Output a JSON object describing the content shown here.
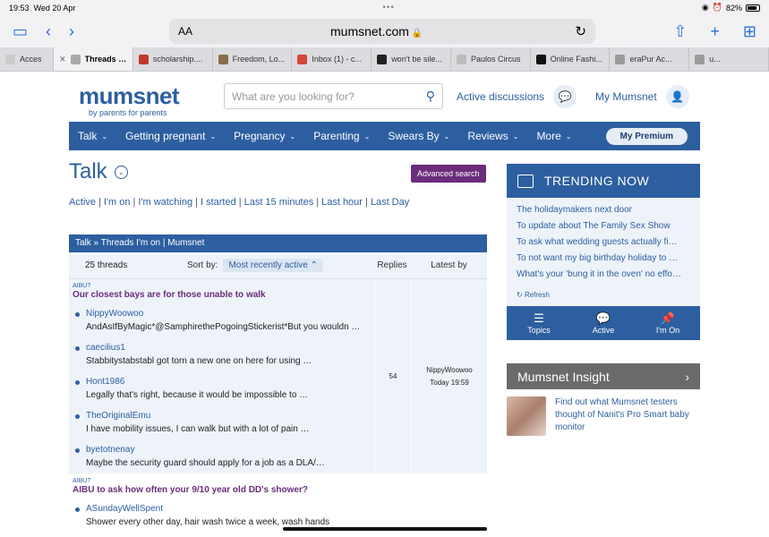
{
  "status": {
    "time": "19:53",
    "date": "Wed 20 Apr",
    "battery": "82%",
    "battery_level": 0.82
  },
  "browser": {
    "aa_label": "AA",
    "url": "mumsnet.com",
    "tabs": [
      {
        "label": "Acces",
        "color": "#cccccc"
      },
      {
        "label": "Threads I'm...",
        "color": "#aaaaaa",
        "active": true
      },
      {
        "label": "scholarship....",
        "color": "#c0392b"
      },
      {
        "label": "Freedom, Lo...",
        "color": "#8a6d4a"
      },
      {
        "label": "Inbox (1) - c...",
        "color": "#d44638"
      },
      {
        "label": "won't be sile...",
        "color": "#222222"
      },
      {
        "label": "Paulos Circus",
        "color": "#bbbbbb"
      },
      {
        "label": "Online Fashi...",
        "color": "#111111"
      },
      {
        "label": "eraPur Ac...",
        "color": "#9a9a9a"
      },
      {
        "label": "u...",
        "color": "#9a9a9a"
      }
    ]
  },
  "site": {
    "logo": "mumsnet",
    "tagline": "by parents for parents",
    "search_placeholder": "What are you looking for?",
    "active_discussions": "Active discussions",
    "my_mumsnet": "My Mumsnet"
  },
  "nav": {
    "items": [
      "Talk",
      "Getting pregnant",
      "Pregnancy",
      "Parenting",
      "Swears By",
      "Reviews",
      "More"
    ],
    "premium": "My Premium"
  },
  "talk": {
    "title": "Talk",
    "advanced_search": "Advanced search",
    "links": [
      "Active",
      "I'm on",
      "I'm watching",
      "I started",
      "Last 15 minutes",
      "Last hour",
      "Last Day"
    ]
  },
  "threads": {
    "breadcrumb": "Talk » Threads I'm on | Mumsnet",
    "count": "25 threads",
    "sort_label": "Sort by:",
    "sort_value": "Most recently active",
    "col_replies": "Replies",
    "col_latest": "Latest by",
    "items": [
      {
        "tag": "AIBU?",
        "title": "Our closest bays are for those unable to walk",
        "replies": "54",
        "latest_user": "NippyWoowoo",
        "latest_time": "Today 19:59",
        "posts": [
          {
            "user": "NippyWoowoo",
            "snippet": "AndAsIfByMagic*@SamphirethePogoingStickerist*But you wouldn …"
          },
          {
            "user": "caecilius1",
            "snippet": "Stabbitystabstabl got torn a new one on here for using …"
          },
          {
            "user": "Hont1986",
            "snippet": "Legally that's right, because it would be impossible to …"
          },
          {
            "user": "TheOriginalEmu",
            "snippet": "I have mobility issues, I can walk but with a lot of pain …"
          },
          {
            "user": "byetotnenay",
            "snippet": "Maybe the security guard should apply for a job as a DLA/…"
          }
        ]
      },
      {
        "tag": "AIBU?",
        "title": "AIBU to ask how often your 9/10 year old DD's shower?",
        "replies": "",
        "latest_user": "",
        "latest_time": "",
        "posts": [
          {
            "user": "ASundayWellSpent",
            "snippet": "Shower every other day, hair wash twice a week, wash hands"
          }
        ]
      }
    ]
  },
  "trending": {
    "title": "TRENDING NOW",
    "items": [
      "The holidaymakers next door",
      "To update about The Family Sex Show",
      "To ask what wedding guests actually fi…",
      "To not want my big birthday holiday to …",
      "What's your 'bung it in the oven' no effo…"
    ],
    "refresh": "Refresh",
    "tabs": [
      "Topics",
      "Active",
      "I'm On"
    ]
  },
  "insight": {
    "title": "Mumsnet Insight",
    "text": "Find out what Mumsnet testers thought of Nanit's Pro Smart baby monitor"
  }
}
